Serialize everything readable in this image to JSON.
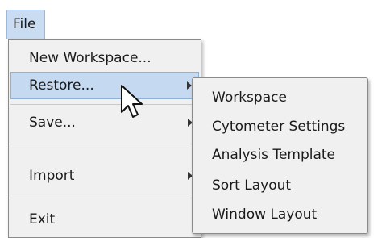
{
  "menubar": {
    "file_label": "File"
  },
  "file_menu": {
    "items": [
      {
        "label": "New Workspace..."
      },
      {
        "label": "Restore..."
      },
      {
        "label": "Save..."
      },
      {
        "label": "Import"
      },
      {
        "label": "Exit"
      }
    ]
  },
  "restore_submenu": {
    "items": [
      {
        "label": "Workspace"
      },
      {
        "label": "Cytometer Settings"
      },
      {
        "label": "Analysis Template"
      },
      {
        "label": "Sort Layout"
      },
      {
        "label": "Window Layout"
      }
    ]
  },
  "icons": {
    "cursor": "mouse-pointer-icon",
    "submenu_arrow": "chevron-right-icon"
  },
  "colors": {
    "highlight": "#c5d9f1",
    "menubar_active": "#c9dcf2",
    "menu_background": "#f0f0f0"
  }
}
